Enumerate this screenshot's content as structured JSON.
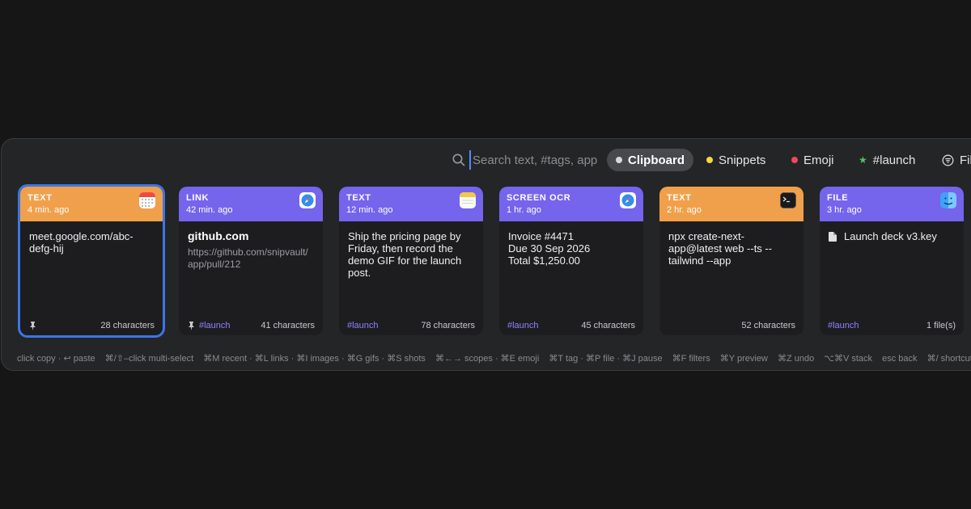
{
  "search": {
    "placeholder": "Search text, #tags, app"
  },
  "scopes": [
    {
      "label": "Clipboard",
      "color": "#d8d8da",
      "active": true
    },
    {
      "label": "Snippets",
      "color": "#f3d94a"
    },
    {
      "label": "Emoji",
      "color": "#f0475b"
    },
    {
      "label": "#launch",
      "color": "#52c45e",
      "icon": "star-icon"
    },
    {
      "label": "Filt",
      "icon": "filter-icon"
    }
  ],
  "cards": [
    {
      "type": "TEXT",
      "time": "4 min. ago",
      "app": "calendar-icon",
      "color": "#f0a04b",
      "content": "meet.google.com/abc-defg-hij",
      "pinned": true,
      "tag": "",
      "count": "28 characters",
      "selected": true
    },
    {
      "type": "LINK",
      "time": "42 min. ago",
      "app": "safari-icon",
      "color": "#7564ec",
      "title": "github.com",
      "url": "https://github.com/snipvault/app/pull/212",
      "pinned": true,
      "tag": "#launch",
      "count": "41 characters"
    },
    {
      "type": "TEXT",
      "time": "12 min. ago",
      "app": "notes-icon",
      "color": "#7564ec",
      "content": "Ship the pricing page by Friday, then record the demo GIF for the launch post.",
      "tag": "#launch",
      "count": "78 characters"
    },
    {
      "type": "SCREEN OCR",
      "time": "1 hr. ago",
      "app": "safari-icon",
      "color": "#7564ec",
      "lines": [
        "Invoice #4471",
        "Due 30 Sep 2026",
        "Total $1,250.00"
      ],
      "tag": "#launch",
      "count": "45 characters"
    },
    {
      "type": "TEXT",
      "time": "2 hr. ago",
      "app": "terminal-icon",
      "color": "#f0a04b",
      "content": "npx create-next-app@latest web --ts --tailwind --app",
      "tag": "",
      "count": "52 characters"
    },
    {
      "type": "FILE",
      "time": "3 hr. ago",
      "app": "finder-icon",
      "color": "#7564ec",
      "filename": "Launch deck v3.key",
      "tag": "#launch",
      "count": "1 file(s)"
    }
  ],
  "shortcuts": [
    "click copy · ↩ paste",
    "⌘/⇧–click multi-select",
    "⌘M recent · ⌘L links · ⌘I images · ⌘G gifs · ⌘S shots",
    "⌘←→ scopes · ⌘E emoji",
    "⌘T tag · ⌘P file · ⌘J pause",
    "⌘F filters",
    "⌘Y preview",
    "⌘Z undo",
    "⌥⌘V stack",
    "esc back",
    "⌘/ shortcuts"
  ]
}
